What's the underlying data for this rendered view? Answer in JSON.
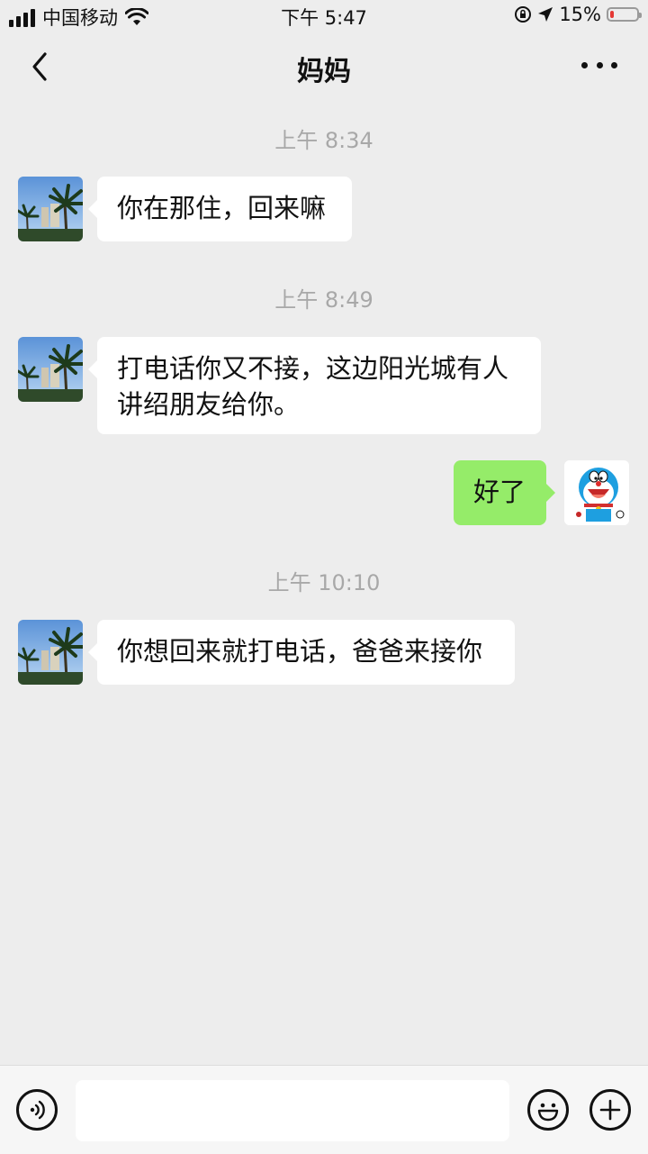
{
  "status_bar": {
    "carrier": "中国移动",
    "time": "下午 5:47",
    "battery_text": "15%",
    "battery_level": 0.15,
    "battery_color": "#e53935",
    "icons": [
      "signal-bars-icon",
      "wifi-icon",
      "rotation-lock-icon",
      "location-arrow-icon",
      "battery-icon"
    ]
  },
  "nav": {
    "title": "妈妈",
    "back_icon": "chevron-left-icon",
    "more_icon": "more-dots-icon"
  },
  "messages": [
    {
      "type": "time",
      "text": "上午 8:34"
    },
    {
      "type": "incoming",
      "text": "你在那住，回来嘛",
      "avatar": "palm-tree-photo"
    },
    {
      "type": "time",
      "text": "上午 8:49"
    },
    {
      "type": "incoming",
      "text": "打电话你又不接，这边阳光城有人讲绍朋友给你。",
      "avatar": "palm-tree-photo"
    },
    {
      "type": "outgoing",
      "text": "好了",
      "avatar": "doraemon-avatar"
    },
    {
      "type": "time",
      "text": "上午 10:10"
    },
    {
      "type": "incoming",
      "text": "你想回来就打电话，爸爸来接你",
      "avatar": "palm-tree-photo"
    }
  ],
  "input_bar": {
    "voice_icon": "voice-icon",
    "emoji_icon": "emoji-icon",
    "plus_icon": "plus-icon",
    "value": ""
  },
  "colors": {
    "background": "#ededed",
    "incoming_bubble": "#ffffff",
    "outgoing_bubble": "#95ec69",
    "time_text": "#a8a8a8"
  }
}
